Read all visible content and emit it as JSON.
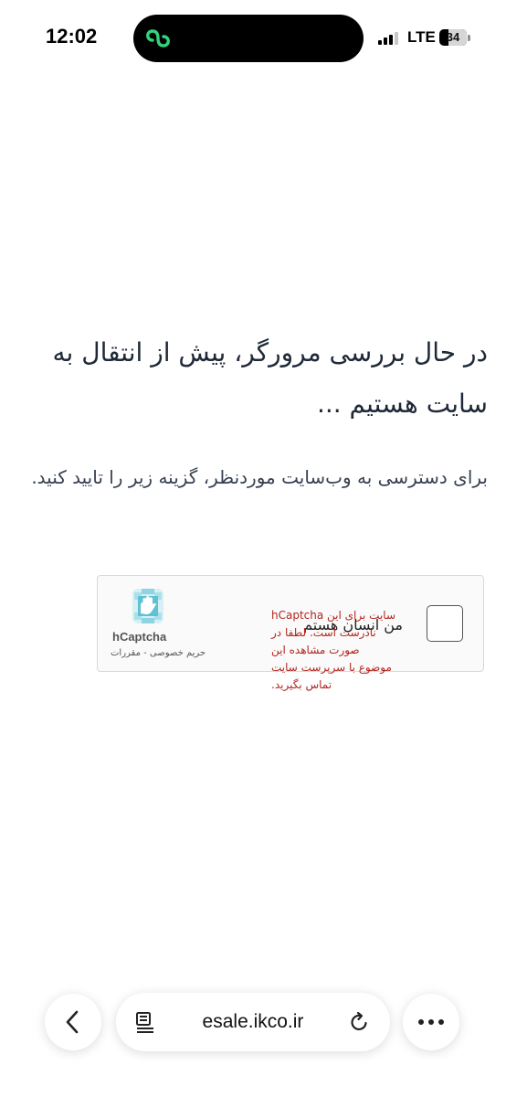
{
  "status_bar": {
    "time": "12:02",
    "network": "LTE",
    "battery": "34",
    "icons": [
      "app-logo-icon",
      "signal-icon",
      "battery-icon"
    ]
  },
  "page": {
    "title": "در حال بررسی مرورگر، پیش از انتقال به سایت هستیم ...",
    "subtitle": "برای دسترسی به وب‌سایت موردنظر، گزینه زیر را تایید کنید."
  },
  "captcha": {
    "checkbox_label": "من انسان هستم",
    "error_message": "سایت برای این hCaptcha نادرست است. لطفا در صورت مشاهده این موضوع با سرپرست سایت تماس بگیرید.",
    "brand": "hCaptcha",
    "links": "حریم خصوصی - مقررات",
    "checked": false
  },
  "browser": {
    "url": "esale.ikco.ir",
    "icons": [
      "back-icon",
      "reader-icon",
      "reload-icon",
      "more-icon"
    ]
  },
  "colors": {
    "error": "#b3261e",
    "captcha_logo_blue": "#5ec2d4"
  }
}
